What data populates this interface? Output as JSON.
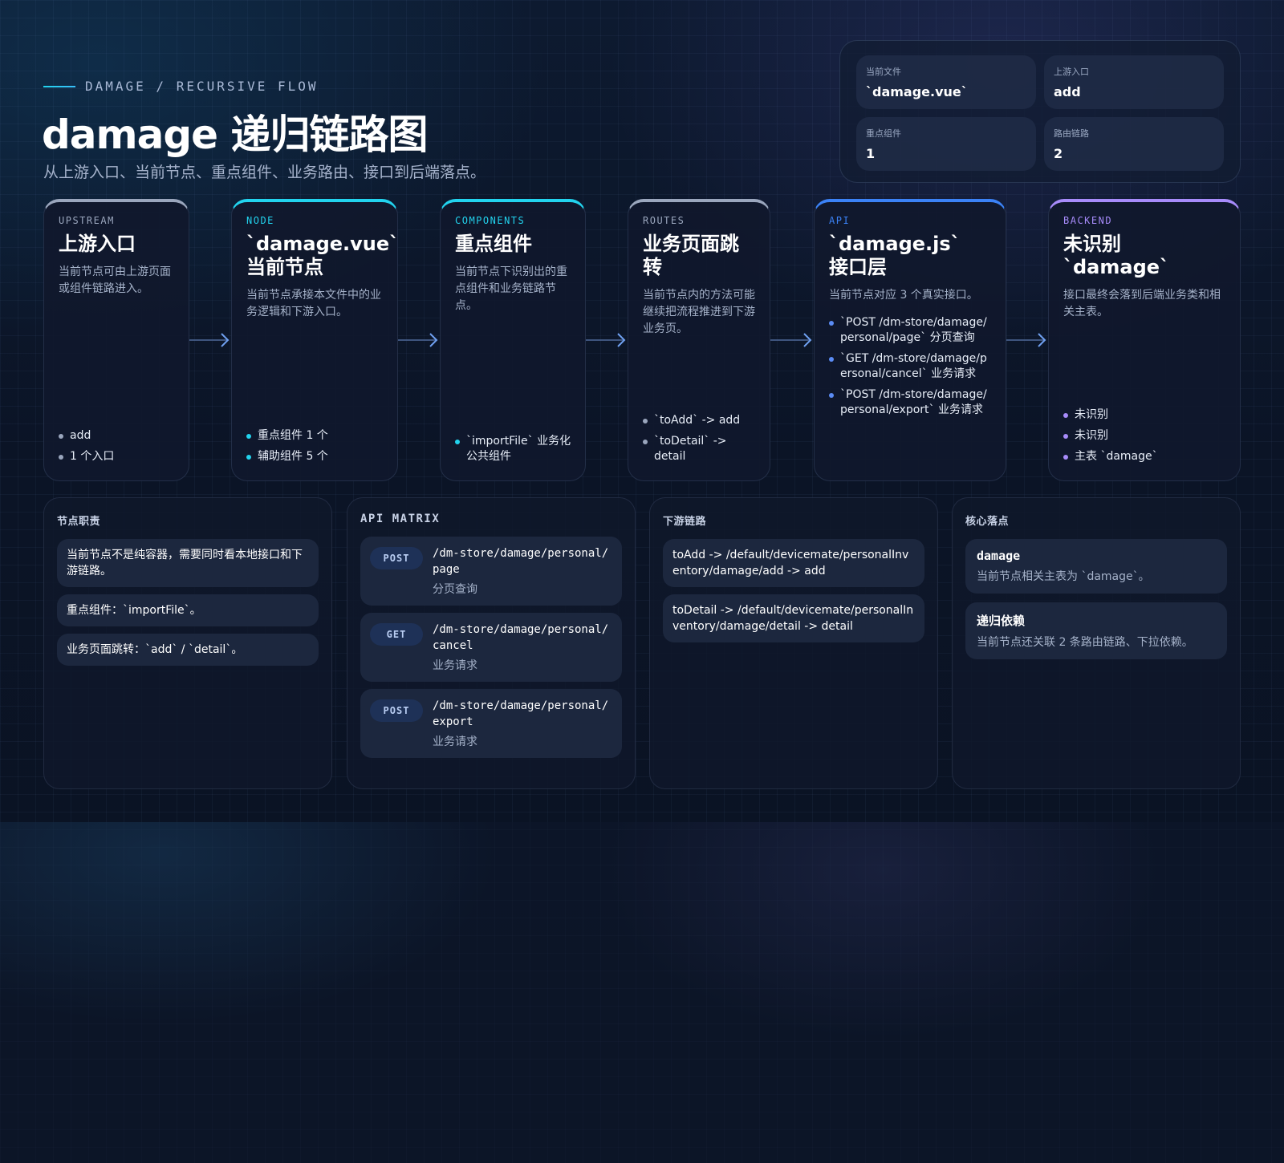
{
  "header": {
    "eyebrow": "DAMAGE / RECURSIVE FLOW",
    "title": "damage 递归链路图",
    "subtitle": "从上游入口、当前节点、重点组件、业务路由、接口到后端落点。"
  },
  "summary": {
    "items": [
      {
        "label": "当前文件",
        "value": "`damage.vue`"
      },
      {
        "label": "上游入口",
        "value": "add"
      },
      {
        "label": "重点组件",
        "value": "1"
      },
      {
        "label": "路由链路",
        "value": "2"
      }
    ]
  },
  "flow": {
    "upstream": {
      "kicker": "UPSTREAM",
      "title": "上游入口",
      "desc": "当前节点可由上游页面或组件链路进入。",
      "items": [
        "add",
        "1 个入口"
      ]
    },
    "node": {
      "kicker": "NODE",
      "title_line1": "`damage.vue`",
      "title_line2": "当前节点",
      "desc": "当前节点承接本文件中的业务逻辑和下游入口。",
      "items": [
        "重点组件 1 个",
        "辅助组件 5 个"
      ]
    },
    "components": {
      "kicker": "COMPONENTS",
      "title": "重点组件",
      "desc": "当前节点下识别出的重点组件和业务链路节点。",
      "items": [
        "`importFile` 业务化公共组件"
      ]
    },
    "routes": {
      "kicker": "ROUTES",
      "title": "业务页面跳转",
      "desc": "当前节点内的方法可能继续把流程推进到下游业务页。",
      "items": [
        "`toAdd` -> add",
        "`toDetail` -> detail"
      ]
    },
    "api": {
      "kicker": "API",
      "title_line1": "`damage.js`",
      "title_line2": "接口层",
      "desc": "当前节点对应 3 个真实接口。",
      "items": [
        "`POST /dm-store/damage/personal/page` 分页查询",
        "`GET /dm-store/damage/personal/cancel` 业务请求",
        "`POST /dm-store/damage/personal/export` 业务请求"
      ]
    },
    "backend": {
      "kicker": "BACKEND",
      "title_line1": "未识别",
      "title_line2": "`damage`",
      "desc": "接口最终会落到后端业务类和相关主表。",
      "items": [
        "未识别",
        "未识别",
        "主表 `damage`"
      ]
    }
  },
  "responsibilities": {
    "heading": "节点职责",
    "items": [
      "当前节点不是纯容器，需要同时看本地接口和下游链路。",
      "重点组件：`importFile`。",
      "业务页面跳转：`add` / `detail`。"
    ]
  },
  "api_matrix": {
    "heading": "API MATRIX",
    "rows": [
      {
        "method": "POST",
        "path": "/dm-store/damage/personal/page",
        "desc": "分页查询"
      },
      {
        "method": "GET",
        "path": "/dm-store/damage/personal/cancel",
        "desc": "业务请求"
      },
      {
        "method": "POST",
        "path": "/dm-store/damage/personal/export",
        "desc": "业务请求"
      }
    ]
  },
  "downstream": {
    "heading": "下游链路",
    "items": [
      "toAdd -> /default/devicemate/personalInventory/damage/add -> add",
      "toDetail -> /default/devicemate/personalInventory/damage/detail -> detail"
    ]
  },
  "core": {
    "heading": "核心落点",
    "items": [
      {
        "title": "damage",
        "desc": "当前节点相关主表为 `damage`。"
      },
      {
        "title": "递归依赖",
        "desc": "当前节点还关联 2 条路由链路、下拉依赖。"
      }
    ]
  },
  "colors": {
    "upstream": "#9aa6bd",
    "node": "#22d3ee",
    "components": "#22d3ee",
    "routes": "#9aa6bd",
    "api": "#3b82f6",
    "backend": "#a78bfa",
    "arrow": "#6fa0f0"
  }
}
